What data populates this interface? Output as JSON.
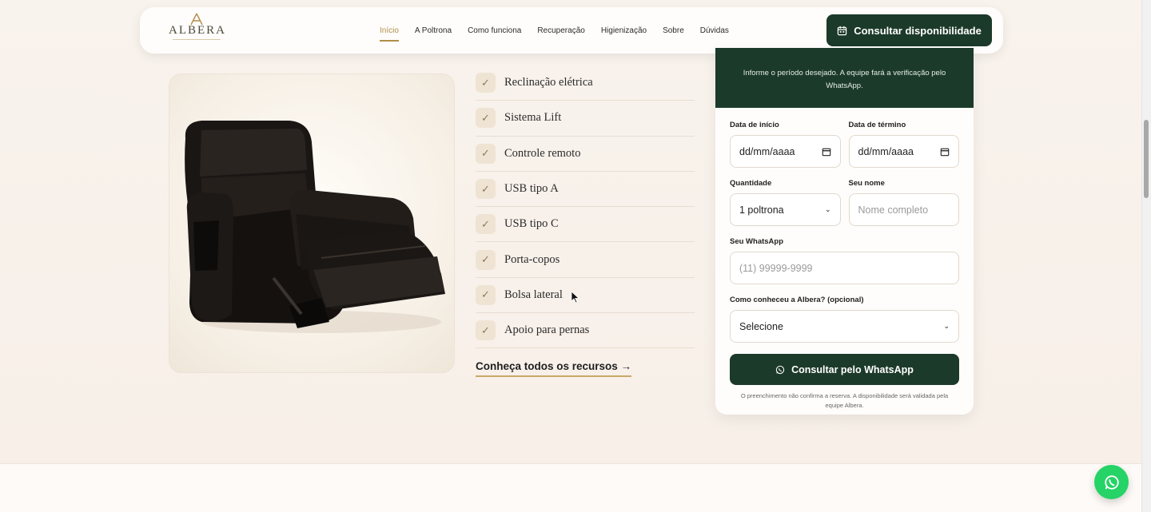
{
  "brand": {
    "name": "ALBERA"
  },
  "nav": {
    "items": [
      "Início",
      "A Poltrona",
      "Como funciona",
      "Recuperação",
      "Higienização",
      "Sobre",
      "Dúvidas"
    ],
    "active": "Início"
  },
  "header": {
    "cta_label": "Consultar disponibilidade",
    "cta_icon": "calendar-icon"
  },
  "features": {
    "items": [
      "Reclinação elétrica",
      "Sistema Lift",
      "Controle remoto",
      "USB tipo A",
      "USB tipo C",
      "Porta-copos",
      "Bolsa lateral",
      "Apoio para pernas"
    ],
    "link_label": "Conheça todos os recursos →"
  },
  "form": {
    "intro": "Informe o período desejado. A equipe fará a verificação pelo WhatsApp.",
    "start_date_label": "Data de início",
    "start_date_value": "dd/mm/aaaa",
    "end_date_label": "Data de término",
    "end_date_value": "dd/mm/aaaa",
    "quantity_label": "Quantidade",
    "quantity_value": "1 poltrona",
    "name_label": "Seu nome",
    "name_placeholder": "Nome completo",
    "whatsapp_label": "Seu WhatsApp",
    "whatsapp_placeholder": "(11) 99999-9999",
    "source_label": "Como conheceu a Albera? (opcional)",
    "source_value": "Selecione",
    "submit_label": "Consultar pelo WhatsApp",
    "disclaimer": "O preenchimento não confirma a reserva. A disponibilidade será validada pela equipe Albera."
  },
  "colors": {
    "brand_green": "#1c3a2a",
    "accent_gold": "#b08d4a",
    "whatsapp": "#25d366"
  }
}
